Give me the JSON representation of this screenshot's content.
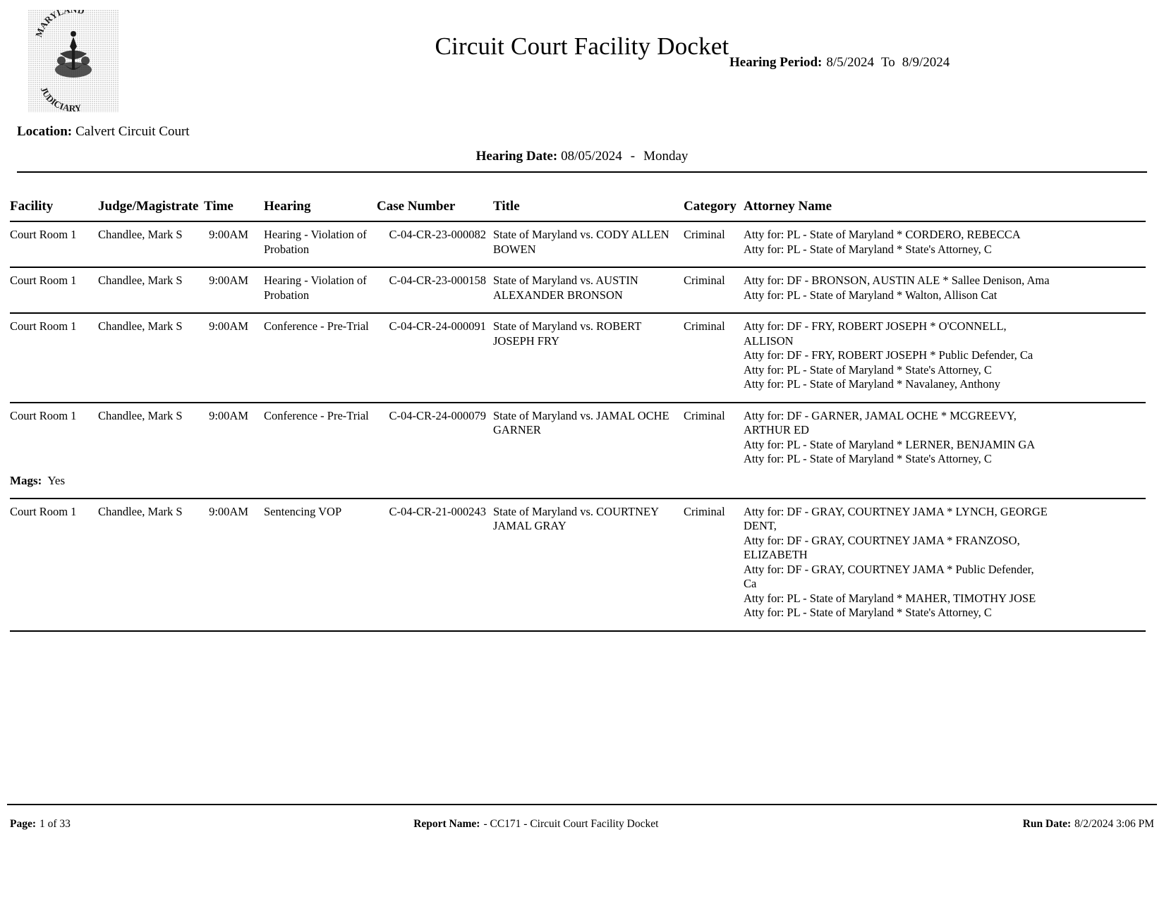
{
  "header": {
    "seal_alt": "Maryland Judiciary Seal",
    "seal_top_text": "MARYLAND",
    "seal_bottom_text": "JUDICIARY",
    "title": "Circuit Court Facility Docket",
    "hearing_period_label": "Hearing Period:",
    "hearing_period_from": "8/5/2024",
    "hearing_period_to_word": "To",
    "hearing_period_to": "8/9/2024",
    "location_label": "Location:",
    "location_value": "Calvert Circuit Court",
    "hearing_date_label": "Hearing Date:",
    "hearing_date_value": "08/05/2024",
    "hearing_date_dash": "-",
    "hearing_date_day": "Monday"
  },
  "table": {
    "columns": [
      "Facility",
      "Judge/Magistrate",
      "Time",
      "Hearing",
      "Case Number",
      "Title",
      "Category",
      "Attorney Name"
    ],
    "rows": [
      {
        "facility": "Court Room 1",
        "judge": "Chandlee, Mark S",
        "time": "9:00AM",
        "hearing": "Hearing - Violation of Probation",
        "case_number": "C-04-CR-23-000082",
        "title": "State of Maryland vs. CODY ALLEN BOWEN",
        "category": "Criminal",
        "attorneys": [
          "Atty for: PL - State of Maryland * CORDERO, REBECCA",
          "Atty for: PL - State of Maryland * State's Attorney, C"
        ],
        "mags": null
      },
      {
        "facility": "Court Room 1",
        "judge": "Chandlee, Mark S",
        "time": "9:00AM",
        "hearing": "Hearing - Violation of Probation",
        "case_number": "C-04-CR-23-000158",
        "title": "State of Maryland vs. AUSTIN ALEXANDER BRONSON",
        "category": "Criminal",
        "attorneys": [
          "Atty for: DF - BRONSON, AUSTIN ALE * Sallee Denison, Ama",
          "Atty for: PL - State of Maryland * Walton, Allison Cat"
        ],
        "mags": null
      },
      {
        "facility": "Court Room 1",
        "judge": "Chandlee, Mark S",
        "time": "9:00AM",
        "hearing": "Conference - Pre-Trial",
        "case_number": "C-04-CR-24-000091",
        "title": "State of Maryland vs. ROBERT JOSEPH FRY",
        "category": "Criminal",
        "attorneys": [
          "Atty for: DF - FRY, ROBERT JOSEPH * O'CONNELL,",
          "ALLISON",
          "Atty for: DF - FRY, ROBERT JOSEPH * Public Defender, Ca",
          "Atty for: PL - State of Maryland * State's Attorney, C",
          "Atty for: PL - State of Maryland * Navalaney, Anthony"
        ],
        "mags": null
      },
      {
        "facility": "Court Room 1",
        "judge": "Chandlee, Mark S",
        "time": "9:00AM",
        "hearing": "Conference - Pre-Trial",
        "case_number": "C-04-CR-24-000079",
        "title": "State of Maryland vs. JAMAL OCHE GARNER",
        "category": "Criminal",
        "attorneys": [
          "Atty for: DF - GARNER, JAMAL OCHE * MCGREEVY,",
          "ARTHUR ED",
          "Atty for: PL - State of Maryland * LERNER, BENJAMIN GA",
          "Atty for: PL - State of Maryland * State's Attorney, C"
        ],
        "mags": {
          "label": "Mags:",
          "value": "Yes"
        }
      },
      {
        "facility": "Court Room 1",
        "judge": "Chandlee, Mark S",
        "time": "9:00AM",
        "hearing": "Sentencing VOP",
        "case_number": "C-04-CR-21-000243",
        "title": "State of Maryland vs. COURTNEY JAMAL GRAY",
        "category": "Criminal",
        "attorneys": [
          "Atty for: DF - GRAY, COURTNEY JAMA * LYNCH, GEORGE",
          "DENT,",
          "Atty for: DF - GRAY, COURTNEY JAMA * FRANZOSO,",
          "ELIZABETH",
          "Atty for: DF - GRAY, COURTNEY JAMA * Public Defender,",
          "Ca",
          "Atty for: PL - State of Maryland * MAHER, TIMOTHY JOSE",
          "Atty for: PL - State of Maryland * State's Attorney, C"
        ],
        "mags": null
      }
    ]
  },
  "footer": {
    "page_label": "Page:",
    "page_value": "1 of 33",
    "report_label": "Report Name:",
    "report_value": "- CC171 - Circuit Court Facility Docket",
    "run_label": "Run Date:",
    "run_value": "8/2/2024 3:06 PM"
  }
}
